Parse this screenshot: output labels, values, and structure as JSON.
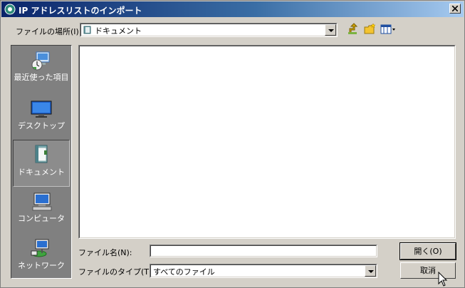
{
  "window": {
    "title": "IP アドレスリストのインポート"
  },
  "location": {
    "label": "ファイルの場所(I):",
    "value": "ドキュメント",
    "icon": "documents-folder-icon"
  },
  "toolbar": {
    "icons": [
      "up-folder-icon",
      "new-folder-icon",
      "view-menu-icon"
    ]
  },
  "places": [
    {
      "label": "最近使った項目",
      "icon": "recent-icon",
      "active": false
    },
    {
      "label": "デスクトップ",
      "icon": "desktop-icon",
      "active": false
    },
    {
      "label": "ドキュメント",
      "icon": "documents-icon",
      "active": true
    },
    {
      "label": "コンピュータ",
      "icon": "computer-icon",
      "active": false
    },
    {
      "label": "ネットワーク",
      "icon": "network-icon",
      "active": false
    }
  ],
  "filename": {
    "label": "ファイル名(N):",
    "value": ""
  },
  "filetype": {
    "label": "ファイルのタイプ(T):",
    "value": "すべてのファイル"
  },
  "buttons": {
    "open": "開く(O)",
    "cancel": "取消"
  },
  "colors": {
    "title_start": "#0a246a",
    "title_end": "#a6caf0",
    "face": "#d4d0c8",
    "places_bg": "#808080"
  }
}
